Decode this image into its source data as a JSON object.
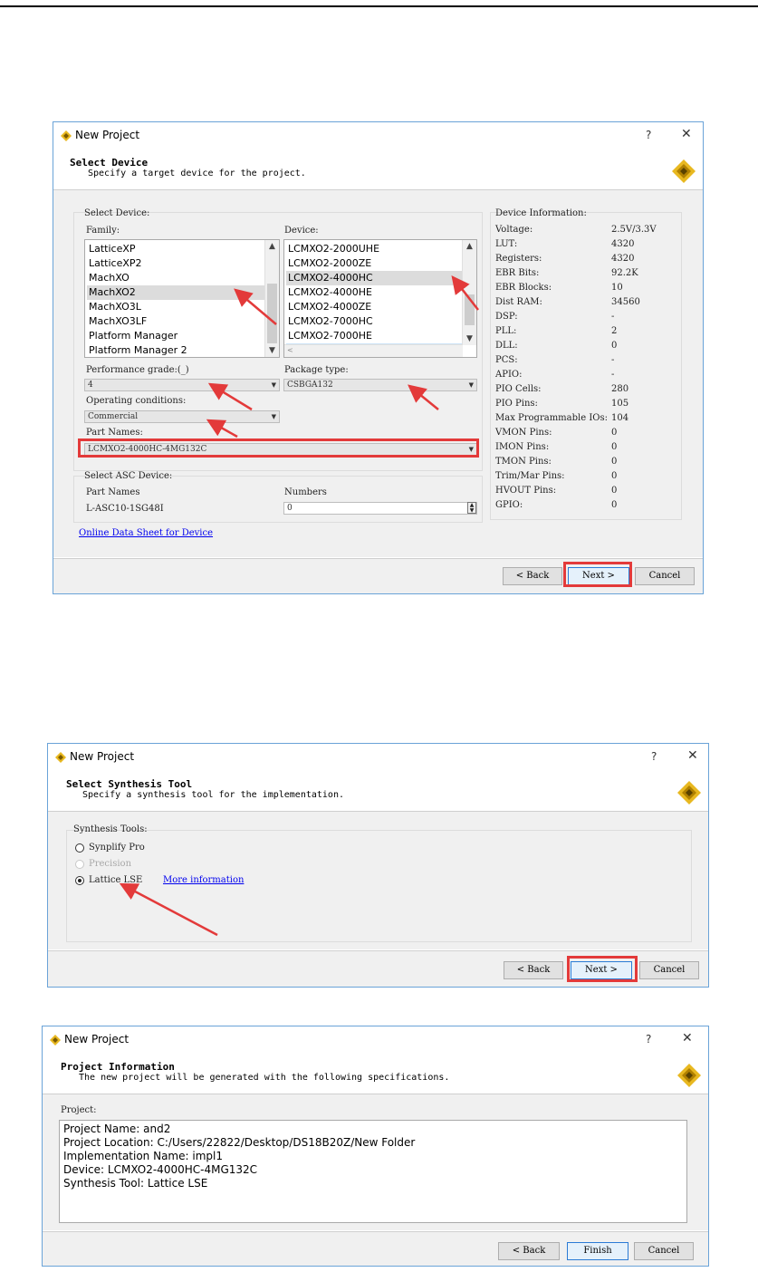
{
  "icons": {
    "app": "lattice-diamond-icon",
    "header": "lattice-diamond-large-icon",
    "help": "question-mark-icon",
    "close": "close-icon",
    "scroll_up": "chevron-up-icon",
    "scroll_down": "chevron-down-icon",
    "dropdown": "dropdown-arrow-icon"
  },
  "colors": {
    "annotation_red": "#e33a3a",
    "window_border": "#6aa3d8",
    "selection": "#dcdcdc",
    "focus_blue": "#2b7bd5"
  },
  "dialog1": {
    "title": "New Project",
    "help": "?",
    "close": "✕",
    "header_title": "Select Device",
    "header_subtitle": "Specify a target device for the project.",
    "select_device_group": "Select Device:",
    "family_label": "Family:",
    "family_items": [
      "LatticeXP",
      "LatticeXP2",
      "MachXO",
      "MachXO2",
      "MachXO3L",
      "MachXO3LF",
      "Platform Manager",
      "Platform Manager 2"
    ],
    "family_selected": "MachXO2",
    "device_label": "Device:",
    "device_items": [
      "LCMXO2-2000UHE",
      "LCMXO2-2000ZE",
      "LCMXO2-4000HC",
      "LCMXO2-4000HE",
      "LCMXO2-4000ZE",
      "LCMXO2-7000HC",
      "LCMXO2-7000HE"
    ],
    "device_selected": "LCMXO2-4000HC",
    "performance_label": "Performance grade:(_)",
    "performance_value": "4",
    "package_label": "Package type:",
    "package_value": "CSBGA132",
    "operating_label": "Operating conditions:",
    "operating_value": "Commercial",
    "part_names_label": "Part Names:",
    "part_names_value": "LCMXO2-4000HC-4MG132C",
    "asc_group": "Select ASC Device:",
    "asc_part_label": "Part Names",
    "asc_part_value": "L-ASC10-1SG48I",
    "asc_numbers_label": "Numbers",
    "asc_numbers_value": "0",
    "online_link": "Online Data Sheet for Device",
    "device_info_title": "Device Information:",
    "device_info": [
      {
        "k": "Voltage:",
        "v": "2.5V/3.3V"
      },
      {
        "k": "LUT:",
        "v": "4320"
      },
      {
        "k": "Registers:",
        "v": "4320"
      },
      {
        "k": "EBR Bits:",
        "v": "92.2K"
      },
      {
        "k": "EBR Blocks:",
        "v": "10"
      },
      {
        "k": "Dist RAM:",
        "v": "34560"
      },
      {
        "k": "DSP:",
        "v": "-"
      },
      {
        "k": "PLL:",
        "v": "2"
      },
      {
        "k": "DLL:",
        "v": "0"
      },
      {
        "k": "PCS:",
        "v": "-"
      },
      {
        "k": "APIO:",
        "v": "-"
      },
      {
        "k": "PIO Cells:",
        "v": "280"
      },
      {
        "k": "PIO Pins:",
        "v": "105"
      },
      {
        "k": "Max Programmable IOs:",
        "v": "104"
      },
      {
        "k": "VMON Pins:",
        "v": "0"
      },
      {
        "k": "IMON Pins:",
        "v": "0"
      },
      {
        "k": "TMON Pins:",
        "v": "0"
      },
      {
        "k": "Trim/Mar Pins:",
        "v": "0"
      },
      {
        "k": "HVOUT Pins:",
        "v": "0"
      },
      {
        "k": "GPIO:",
        "v": "0"
      }
    ],
    "back": "< Back",
    "next": "Next >",
    "cancel": "Cancel"
  },
  "dialog2": {
    "title": "New Project",
    "help": "?",
    "close": "✕",
    "header_title": "Select Synthesis Tool",
    "header_subtitle": "Specify a synthesis tool for the implementation.",
    "group_label": "Synthesis Tools:",
    "option1": "Synplify Pro",
    "option2": "Precision",
    "option3": "Lattice LSE",
    "more_info": "More information",
    "back": "< Back",
    "next": "Next >",
    "cancel": "Cancel"
  },
  "dialog3": {
    "title": "New Project",
    "help": "?",
    "close": "✕",
    "header_title": "Project Information",
    "header_subtitle": "The new project will be generated with the following specifications.",
    "project_label": "Project:",
    "lines": [
      "Project Name: and2",
      "Project Location: C:/Users/22822/Desktop/DS18B20Z/New Folder",
      "Implementation Name: impl1",
      "Device: LCMXO2-4000HC-4MG132C",
      "Synthesis Tool: Lattice LSE"
    ],
    "back": "< Back",
    "finish": "Finish",
    "cancel": "Cancel"
  }
}
